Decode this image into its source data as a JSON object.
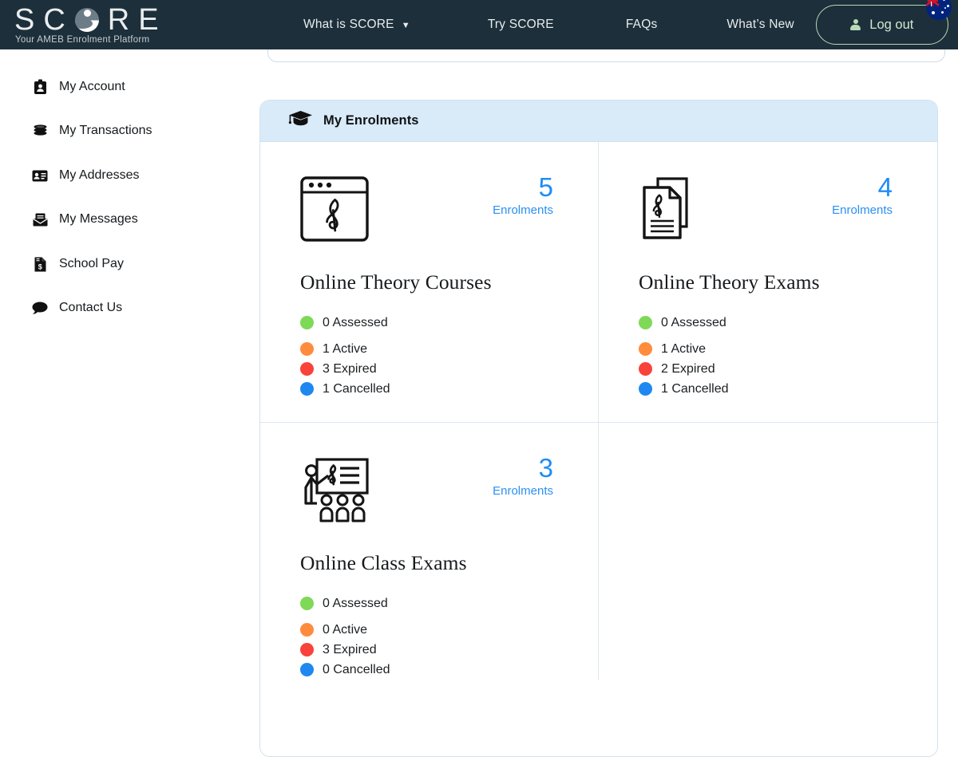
{
  "header": {
    "brand_name": "SCORE",
    "brand_letters_before": "SC",
    "brand_letters_after": "RE",
    "brand_tagline": "Your AMEB Enrolment Platform",
    "globe_icon": "globe-icon",
    "nav": [
      {
        "label": "What is SCORE",
        "has_caret": true,
        "caret": "▼"
      },
      {
        "label": "Try SCORE",
        "has_caret": false
      },
      {
        "label": "FAQs",
        "has_caret": false
      },
      {
        "label": "What’s New",
        "has_caret": false
      }
    ],
    "logout_label": "Log out",
    "logout_icon": "person-icon",
    "flag_icon": "australian-flag-icon",
    "background_color": "#1d2f3a",
    "logout_border_color": "#b6d7b9"
  },
  "sidebar": {
    "items": [
      {
        "label": "My Account",
        "icon": "id-badge-icon"
      },
      {
        "label": "My Transactions",
        "icon": "coins-icon"
      },
      {
        "label": "My Addresses",
        "icon": "address-card-icon"
      },
      {
        "label": "My Messages",
        "icon": "envelope-icon"
      },
      {
        "label": "School Pay",
        "icon": "invoice-dollar-icon"
      },
      {
        "label": "Contact Us",
        "icon": "speech-bubble-icon"
      }
    ]
  },
  "main": {
    "panel": {
      "title": "My Enrolments",
      "icon": "graduation-cap-icon",
      "header_color": "#d9eaf9"
    },
    "status_colors": {
      "assessed": "#7ed957",
      "active": "#ff8b3d",
      "expired": "#f9423a",
      "cancelled": "#1e88f0"
    },
    "count_color": "#1f8cf5",
    "enrolments_label": "Enrolments",
    "cards": [
      {
        "title": "Online Theory Courses",
        "icon": "browser-treble-clef-icon",
        "count": "5",
        "enrolments_label": "Enrolments",
        "stats": [
          {
            "label": "0 Assessed",
            "count": "0",
            "status": "Assessed",
            "color": "#7ed957"
          },
          {
            "label": "1 Active",
            "count": "1",
            "status": "Active",
            "color": "#ff8b3d"
          },
          {
            "label": "3 Expired",
            "count": "3",
            "status": "Expired",
            "color": "#f9423a"
          },
          {
            "label": "1 Cancelled",
            "count": "1",
            "status": "Cancelled",
            "color": "#1e88f0"
          }
        ]
      },
      {
        "title": "Online Theory Exams",
        "icon": "documents-treble-clef-icon",
        "count": "4",
        "enrolments_label": "Enrolments",
        "stats": [
          {
            "label": "0 Assessed",
            "count": "0",
            "status": "Assessed",
            "color": "#7ed957"
          },
          {
            "label": "1 Active",
            "count": "1",
            "status": "Active",
            "color": "#ff8b3d"
          },
          {
            "label": "2 Expired",
            "count": "2",
            "status": "Expired",
            "color": "#f9423a"
          },
          {
            "label": "1 Cancelled",
            "count": "1",
            "status": "Cancelled",
            "color": "#1e88f0"
          }
        ]
      },
      {
        "title": "Online Class Exams",
        "icon": "classroom-treble-clef-icon",
        "count": "3",
        "enrolments_label": "Enrolments",
        "stats": [
          {
            "label": "0 Assessed",
            "count": "0",
            "status": "Assessed",
            "color": "#7ed957"
          },
          {
            "label": "0 Active",
            "count": "0",
            "status": "Active",
            "color": "#ff8b3d"
          },
          {
            "label": "3 Expired",
            "count": "3",
            "status": "Expired",
            "color": "#f9423a"
          },
          {
            "label": "0 Cancelled",
            "count": "0",
            "status": "Cancelled",
            "color": "#1e88f0"
          }
        ]
      }
    ]
  }
}
